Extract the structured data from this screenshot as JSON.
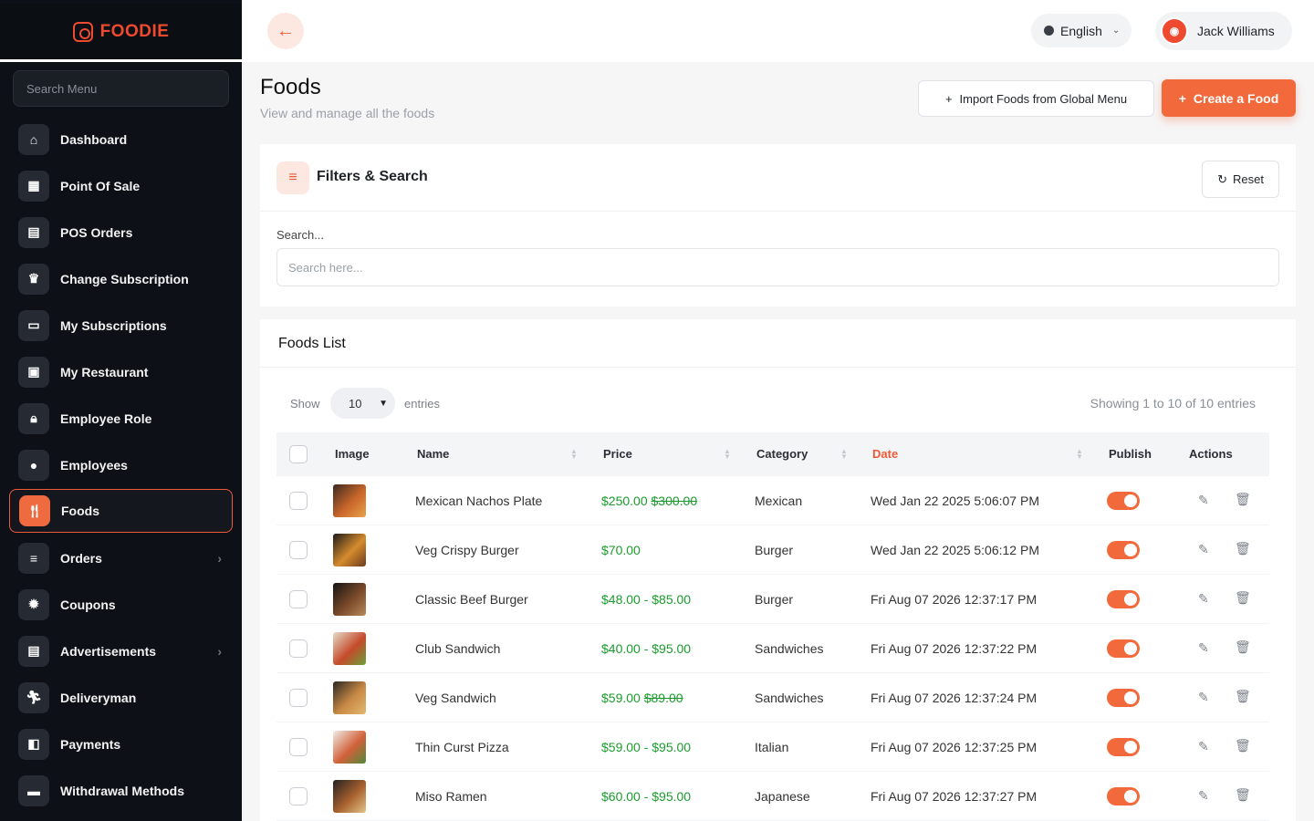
{
  "brand": {
    "name": "FOODIE"
  },
  "sidebar": {
    "search_placeholder": "Search Menu",
    "items": [
      {
        "label": "Dashboard",
        "icon": "home-icon",
        "glyph": "⌂"
      },
      {
        "label": "Point Of Sale",
        "icon": "calculator-icon",
        "glyph": "▦"
      },
      {
        "label": "POS Orders",
        "icon": "receipt-icon",
        "glyph": "▤"
      },
      {
        "label": "Change Subscription",
        "icon": "crown-icon",
        "glyph": "♛"
      },
      {
        "label": "My Subscriptions",
        "icon": "monitor-icon",
        "glyph": "▭"
      },
      {
        "label": "My Restaurant",
        "icon": "store-icon",
        "glyph": "▣"
      },
      {
        "label": "Employee Role",
        "icon": "lock-icon",
        "glyph": "🔒︎"
      },
      {
        "label": "Employees",
        "icon": "user-icon",
        "glyph": "●"
      },
      {
        "label": "Foods",
        "icon": "food-icon",
        "glyph": "🍴︎",
        "active": true
      },
      {
        "label": "Orders",
        "icon": "list-icon",
        "glyph": "≡",
        "has_submenu": true
      },
      {
        "label": "Coupons",
        "icon": "badge-icon",
        "glyph": "✹"
      },
      {
        "label": "Advertisements",
        "icon": "ad-icon",
        "glyph": "▤",
        "has_submenu": true
      },
      {
        "label": "Deliveryman",
        "icon": "runner-icon",
        "glyph": "🏃︎"
      },
      {
        "label": "Payments",
        "icon": "wallet-icon",
        "glyph": "◧"
      },
      {
        "label": "Withdrawal Methods",
        "icon": "card-icon",
        "glyph": "▬"
      }
    ]
  },
  "topbar": {
    "language": "English",
    "user_name": "Jack Williams"
  },
  "page": {
    "title": "Foods",
    "subtitle": "View and manage all the foods",
    "import_label": "Import Foods from Global Menu",
    "create_label": "Create a Food"
  },
  "filters": {
    "title": "Filters & Search",
    "reset_label": "Reset",
    "search_label": "Search...",
    "search_placeholder": "Search here..."
  },
  "list": {
    "title": "Foods List",
    "show_label": "Show",
    "page_size": "10",
    "entries_label": "entries",
    "showing_text": "Showing 1 to 10 of 10 entries",
    "columns": [
      "Image",
      "Name",
      "Price",
      "Category",
      "Date",
      "Publish",
      "Actions"
    ],
    "rows": [
      {
        "name": "Mexican Nachos Plate",
        "price": "$250.00",
        "old_price": "$300.00",
        "category": "Mexican",
        "date": "Wed Jan 22 2025 5:06:07 PM",
        "published": true,
        "thumb_colors": [
          "#3b2a20",
          "#c9662a",
          "#e9a34a"
        ]
      },
      {
        "name": "Veg Crispy Burger",
        "price": "$70.00",
        "old_price": "",
        "category": "Burger",
        "date": "Wed Jan 22 2025 5:06:12 PM",
        "published": true,
        "thumb_colors": [
          "#1d1a17",
          "#d58b2e",
          "#6b3b1c"
        ]
      },
      {
        "name": "Classic Beef Burger",
        "price": "$48.00 - $85.00",
        "old_price": "",
        "category": "Burger",
        "date": "Fri Aug 07 2026 12:37:17 PM",
        "published": true,
        "thumb_colors": [
          "#141414",
          "#7a4a2a",
          "#b98a5a"
        ]
      },
      {
        "name": "Club Sandwich",
        "price": "$40.00 - $95.00",
        "old_price": "",
        "category": "Sandwiches",
        "date": "Fri Aug 07 2026 12:37:22 PM",
        "published": true,
        "thumb_colors": [
          "#e6dccb",
          "#c54a2a",
          "#6aa03a"
        ]
      },
      {
        "name": "Veg Sandwich",
        "price": "$59.00",
        "old_price": "$89.00",
        "category": "Sandwiches",
        "date": "Fri Aug 07 2026 12:37:24 PM",
        "published": true,
        "thumb_colors": [
          "#2b2622",
          "#c88a46",
          "#e3b870"
        ]
      },
      {
        "name": "Thin Curst Pizza",
        "price": "$59.00 - $95.00",
        "old_price": "",
        "category": "Italian",
        "date": "Fri Aug 07 2026 12:37:25 PM",
        "published": true,
        "thumb_colors": [
          "#f0ede6",
          "#d2613a",
          "#4f8a3a"
        ]
      },
      {
        "name": "Miso Ramen",
        "price": "$60.00 - $95.00",
        "old_price": "",
        "category": "Japanese",
        "date": "Fri Aug 07 2026 12:37:27 PM",
        "published": true,
        "thumb_colors": [
          "#232120",
          "#a9622f",
          "#e3c48a"
        ]
      }
    ]
  },
  "colors": {
    "accent": "#f26a3c",
    "sidebar_bg": "#0d1117",
    "price_green": "#1a9b2d"
  }
}
